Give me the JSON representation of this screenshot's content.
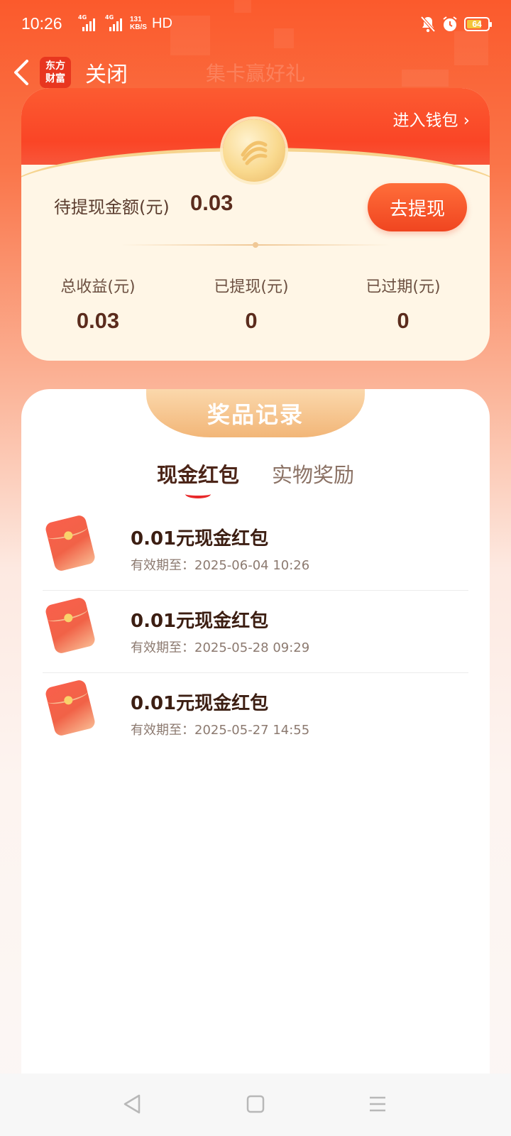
{
  "status_bar": {
    "time": "10:26",
    "signal1_label": "4G",
    "signal2_label": "4G",
    "speed_value": "131",
    "speed_unit": "KB/S",
    "hd": "HD",
    "battery": "64",
    "icons": [
      "mute-bell-icon",
      "alarm-icon",
      "battery-icon"
    ]
  },
  "nav": {
    "logo_line1": "东方",
    "logo_line2": "财富",
    "close_label": "关闭",
    "title": "集卡赢好礼"
  },
  "wallet": {
    "enter_wallet": "进入钱包",
    "pending_label": "待提现金额(元)",
    "pending_value": "0.03",
    "withdraw_button": "去提现",
    "stats": [
      {
        "label": "总收益(元)",
        "value": "0.03"
      },
      {
        "label": "已提现(元)",
        "value": "0"
      },
      {
        "label": "已过期(元)",
        "value": "0"
      }
    ]
  },
  "prizes": {
    "banner": "奖品记录",
    "tabs": [
      {
        "label": "现金红包",
        "active": true
      },
      {
        "label": "实物奖励",
        "active": false
      }
    ],
    "items": [
      {
        "title": "0.01元现金红包",
        "expiry": "有效期至：2025-06-04 10:26"
      },
      {
        "title": "0.01元现金红包",
        "expiry": "有效期至：2025-05-28 09:29"
      },
      {
        "title": "0.01元现金红包",
        "expiry": "有效期至：2025-05-27 14:55"
      }
    ]
  },
  "colors": {
    "brand_orange": "#fb5a2c",
    "button_red": "#f04520",
    "card_cream": "#fff6e6",
    "text_brown": "#5b2c1d"
  }
}
